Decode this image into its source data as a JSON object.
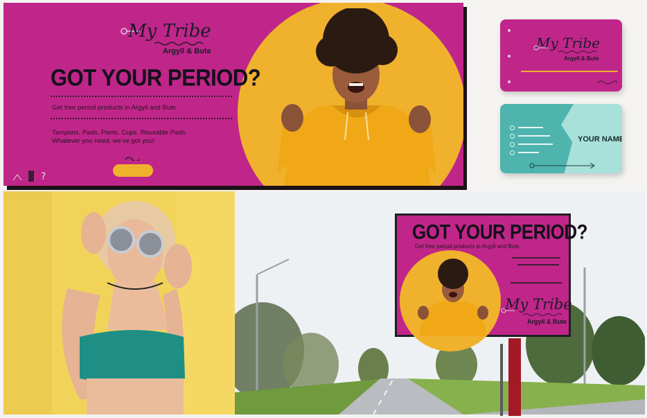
{
  "colors": {
    "magenta": "#c02689",
    "mustard": "#f0b22d",
    "teal": "#4eb4ad",
    "mint": "#a8e1da",
    "dark": "#15101b",
    "wall_yellow": "#f2d35a"
  },
  "banner": {
    "logo_title": "My Tribe",
    "logo_subtitle": "Argyll & Bute",
    "headline": "GOT YOUR PERIOD?",
    "tagline": "Get free period products in Argyll and Bute.",
    "products_line": "Tampons. Pads. Pants. Cups. Reusable Pads.",
    "whatever_line": "Whatever you need, we've got you!"
  },
  "business_card_back": {
    "name": "YOUR NAME"
  },
  "billboard": {
    "headline": "GOT YOUR PERIOD?",
    "tagline": "Get free period products in Argyll and Bute.",
    "logo_title": "My Tribe",
    "logo_subtitle": "Argyll & Bute"
  }
}
